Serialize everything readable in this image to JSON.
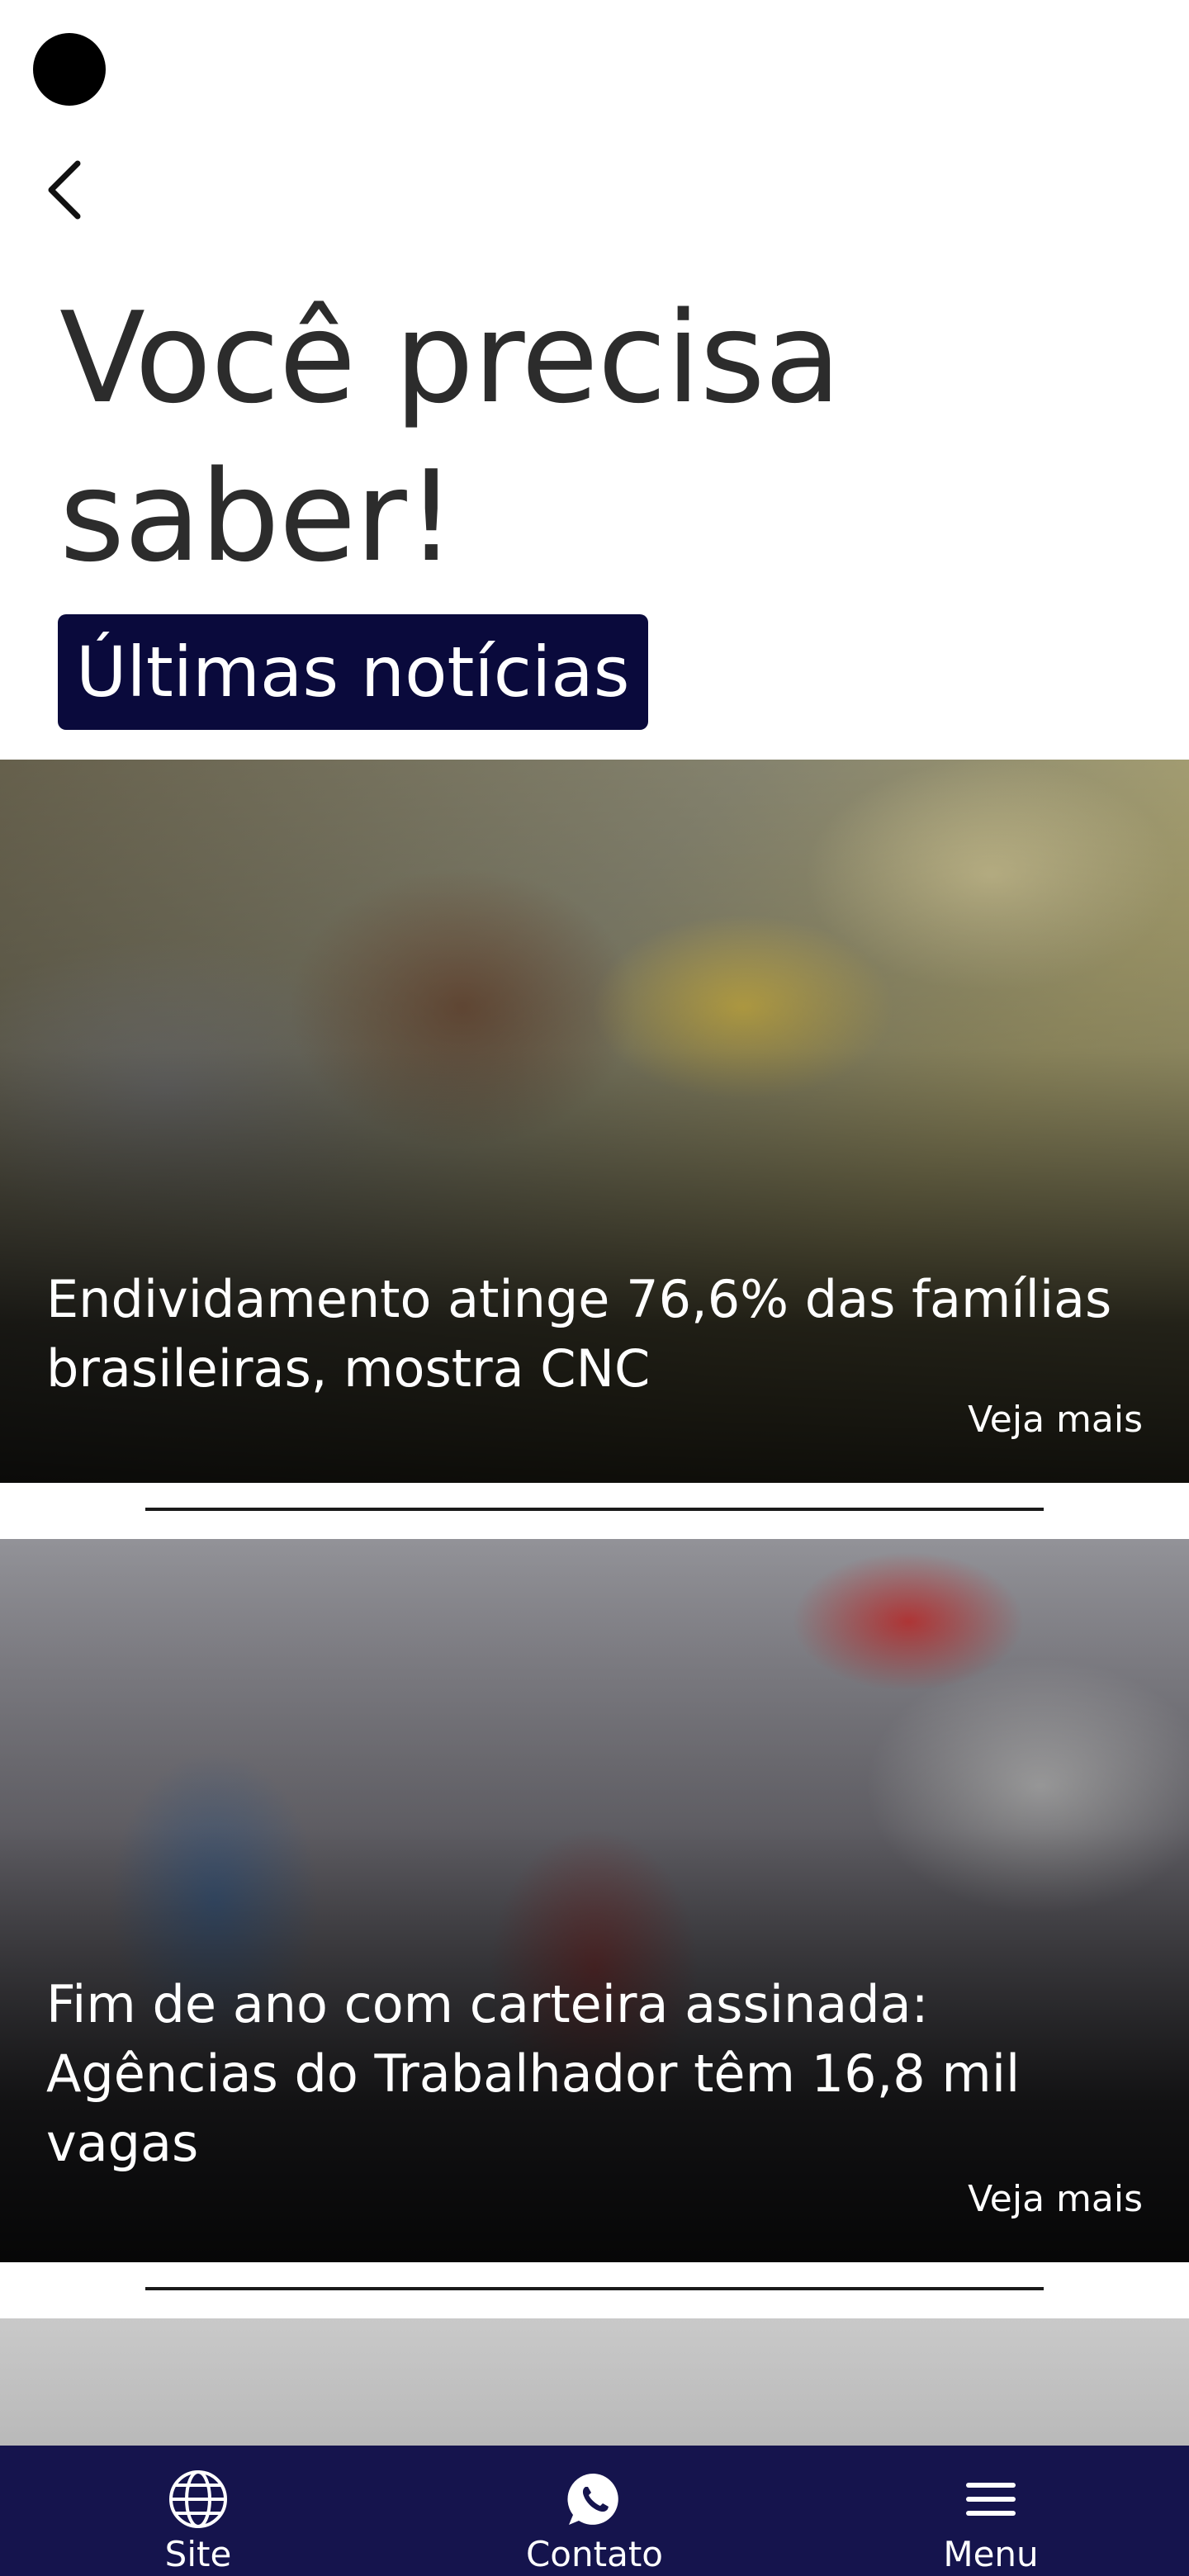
{
  "header": {
    "back_icon": "chevron-left-icon",
    "title": "Você precisa saber!",
    "section_label": "Últimas notícias"
  },
  "news": [
    {
      "title": "Endividamento atinge 76,6% das famílias brasileiras, mostra CNC",
      "more_label": "Veja mais"
    },
    {
      "title": "Fim de ano com carteira assinada: Agências do Trabalhador têm 16,8 mil vagas",
      "more_label": "Veja mais"
    }
  ],
  "bottom_nav": {
    "items": [
      {
        "label": "Site",
        "icon": "globe-icon"
      },
      {
        "label": "Contato",
        "icon": "whatsapp-icon"
      },
      {
        "label": "Menu",
        "icon": "hamburger-menu-icon"
      }
    ]
  },
  "colors": {
    "nav_background": "#15144d",
    "badge_background": "#0a0a3c",
    "title_text": "#2c2c2c"
  }
}
